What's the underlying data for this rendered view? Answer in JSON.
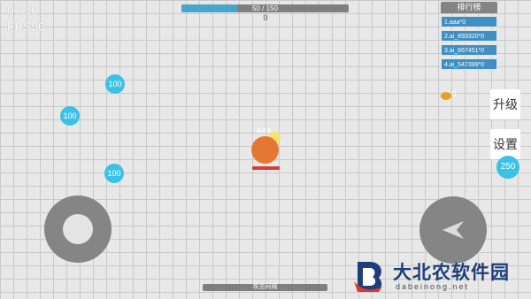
{
  "hud": {
    "time": "07:50",
    "fps": "FPS56"
  },
  "xp": {
    "label": "50 / 150",
    "fraction": 0.333,
    "score": "0"
  },
  "leaderboard": {
    "title": "排行榜",
    "rows": [
      "1.aaa*0",
      "2.ai_893320*0",
      "3.ai_667451*0",
      "4.ai_547399*0"
    ]
  },
  "buttons": {
    "upgrade": "升级",
    "settings": "设置"
  },
  "orbs": [
    "100",
    "100",
    "100",
    "250"
  ],
  "coin": {
    "count": "0",
    "color": "#e6a31a"
  },
  "player": {
    "name": "aaa",
    "color": "#e47832",
    "hp_fraction": 1.0
  },
  "joysticks": {
    "left_icon": "move-joystick",
    "right_icon": "fire-arrow-icon"
  },
  "bottom_bar": {
    "label": "攻击间隔"
  },
  "watermark": {
    "main": "大北农软件园",
    "sub": "dabeinong.net"
  }
}
